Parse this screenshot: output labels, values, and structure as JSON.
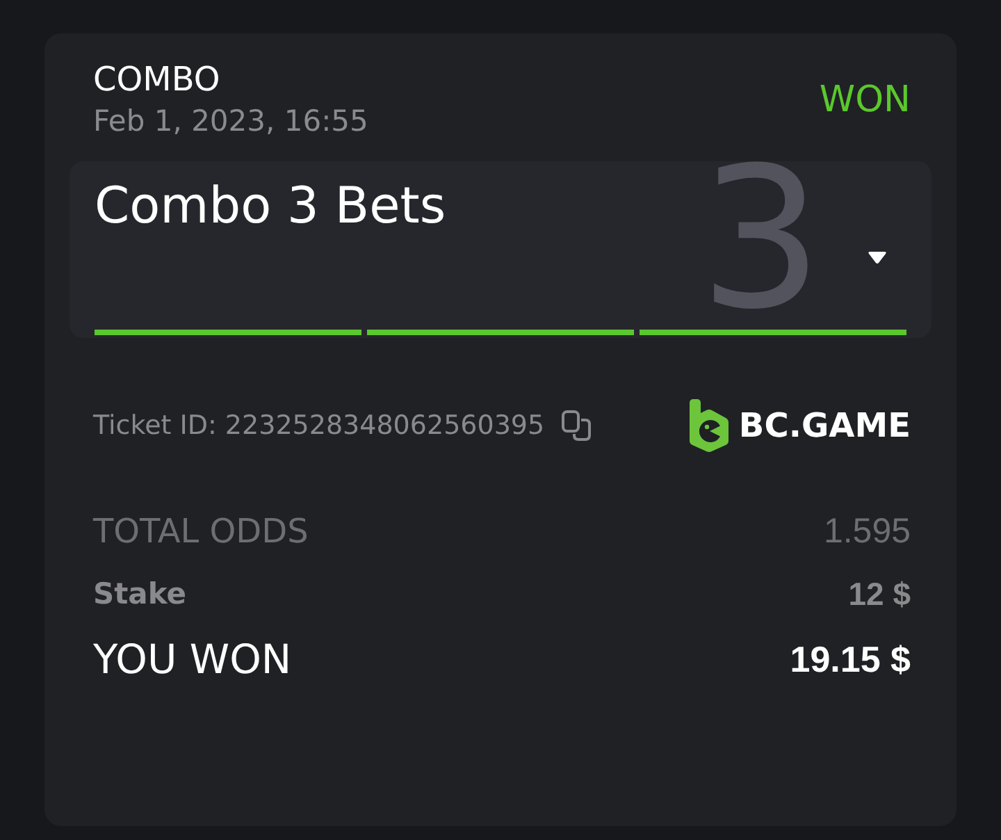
{
  "bet": {
    "type": "COMBO",
    "date": "Feb 1, 2023, 16:55",
    "status": "WON"
  },
  "combo": {
    "title": "Combo 3 Bets",
    "leg_count": "3",
    "expanded": false,
    "legs": [
      {
        "won": true
      },
      {
        "won": true
      },
      {
        "won": true
      }
    ]
  },
  "ticket": {
    "id_text": "Ticket ID: 2232528348062560395"
  },
  "brand": {
    "name": "BC.GAME"
  },
  "summary": [
    {
      "kind": "odds",
      "label": "TOTAL ODDS",
      "value": "1.595"
    },
    {
      "kind": "stake",
      "label": "Stake",
      "value": "12 $"
    },
    {
      "kind": "payout",
      "label": "YOU WON",
      "value": "19.15 $"
    }
  ]
}
